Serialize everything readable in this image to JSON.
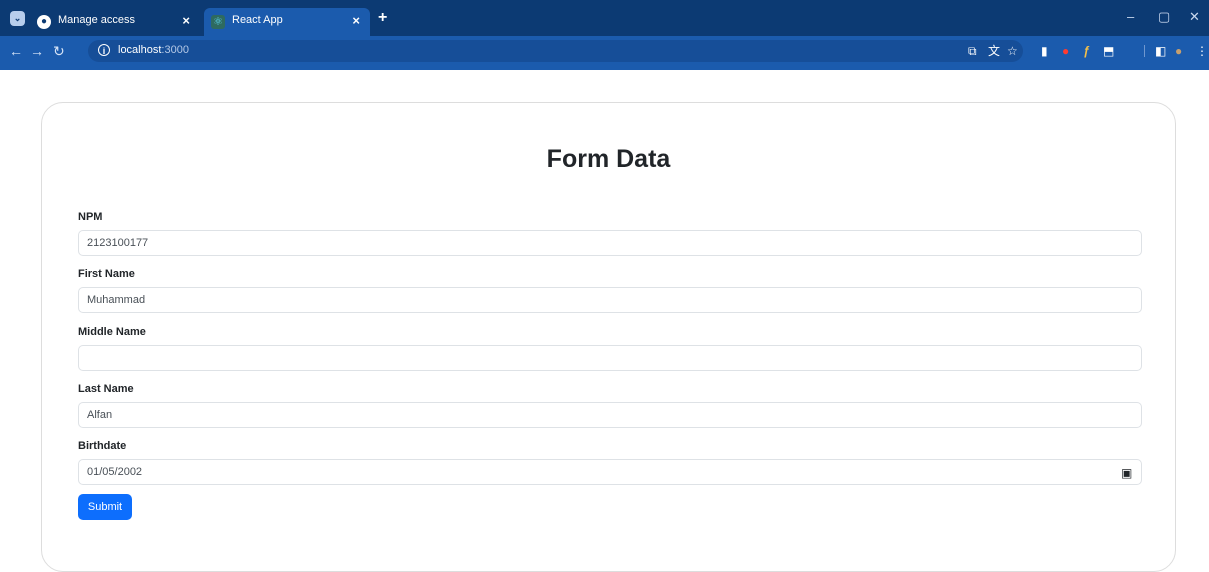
{
  "browser": {
    "tabs": [
      {
        "title": "Manage access",
        "icon": "github-icon"
      },
      {
        "title": "React App",
        "icon": "react-icon"
      }
    ],
    "close_glyph": "×",
    "new_tab_glyph": "+",
    "url_host": "localhost",
    "url_port": ":3000",
    "window_controls": {
      "minimize": "–",
      "restore": "▢",
      "close": "✕"
    }
  },
  "form": {
    "title": "Form Data",
    "fields": [
      {
        "label": "NPM",
        "value": "2123100177"
      },
      {
        "label": "First Name",
        "value": "Muhammad"
      },
      {
        "label": "Middle Name",
        "value": ""
      },
      {
        "label": "Last Name",
        "value": "Alfan"
      },
      {
        "label": "Birthdate",
        "value": "01/05/2002"
      }
    ],
    "submit_label": "Submit"
  },
  "colors": {
    "accent": "#0d6efd",
    "tabstrip": "#0c3a73",
    "toolbar": "#1b5bad"
  }
}
